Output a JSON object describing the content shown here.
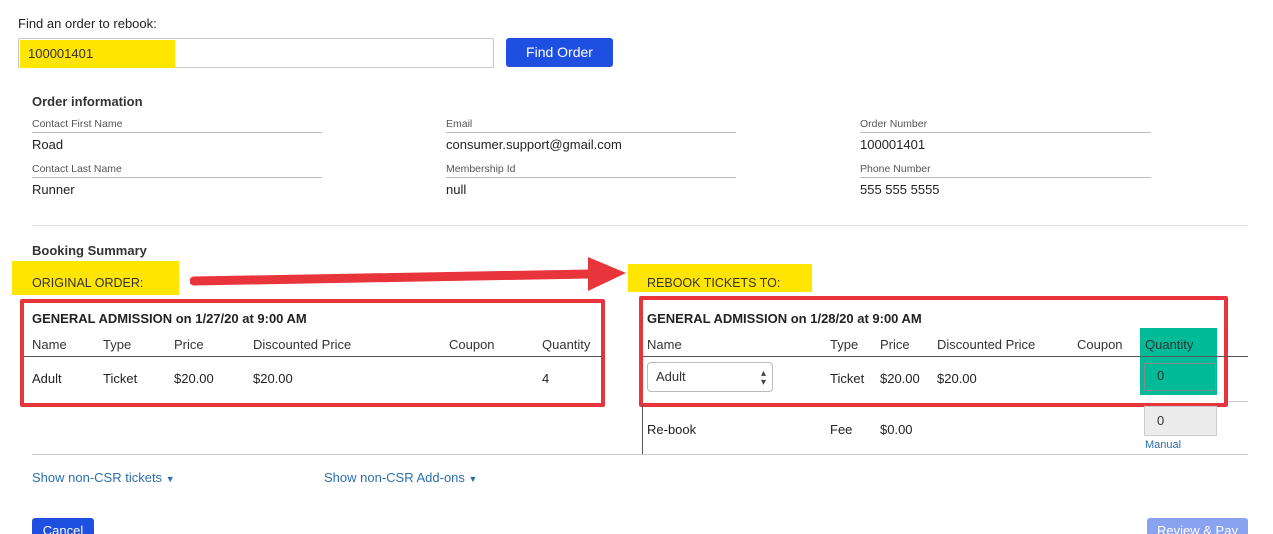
{
  "search": {
    "prompt": "Find an order to rebook:",
    "value": "100001401",
    "find_button": "Find Order"
  },
  "order_info": {
    "title": "Order information",
    "fields": {
      "first_name": {
        "label": "Contact First Name",
        "value": "Road"
      },
      "last_name": {
        "label": "Contact Last Name",
        "value": "Runner"
      },
      "email": {
        "label": "Email",
        "value": "consumer.support@gmail.com"
      },
      "membership": {
        "label": "Membership Id",
        "value": "null"
      },
      "order_number": {
        "label": "Order Number",
        "value": "100001401"
      },
      "phone": {
        "label": "Phone Number",
        "value": "555 555 5555"
      }
    }
  },
  "booking": {
    "title": "Booking Summary",
    "original_label": "ORIGINAL ORDER:",
    "rebook_label": "REBOOK TICKETS TO:",
    "original": {
      "event": "GENERAL ADMISSION on 1/27/20 at 9:00 AM",
      "columns": [
        "Name",
        "Type",
        "Price",
        "Discounted Price",
        "Coupon",
        "Quantity"
      ],
      "row": {
        "name": "Adult",
        "type": "Ticket",
        "price": "$20.00",
        "discounted": "$20.00",
        "coupon": "",
        "quantity": "4"
      }
    },
    "rebook": {
      "event": "GENERAL ADMISSION on 1/28/20 at 9:00 AM",
      "columns": [
        "Name",
        "Type",
        "Price",
        "Discounted Price",
        "Coupon",
        "Quantity"
      ],
      "row": {
        "name": "Adult",
        "type": "Ticket",
        "price": "$20.00",
        "discounted": "$20.00",
        "quantity": "0"
      },
      "fee_row": {
        "name": "Re-book",
        "type": "Fee",
        "price": "$0.00",
        "quantity": "0",
        "manual_link": "Manual"
      }
    },
    "show_tickets": "Show non-CSR tickets",
    "show_addons": "Show non-CSR Add-ons"
  },
  "footer": {
    "cancel": "Cancel",
    "review": "Review & Pay"
  },
  "colors": {
    "primary": "#1f4fe0",
    "highlight_yellow": "#ffe500",
    "annotation_red": "#e8353b",
    "highlight_teal": "#00bb98"
  }
}
